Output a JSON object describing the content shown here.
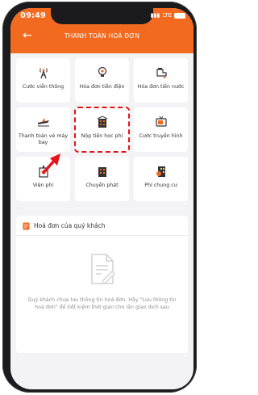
{
  "status": {
    "time": "09:49",
    "network": "LTE"
  },
  "header": {
    "title": "THANH TOÁN HOÁ ĐƠN",
    "back_icon": "arrow-left-icon"
  },
  "services": [
    {
      "label": "Cước viễn thông",
      "icon": "antenna-icon"
    },
    {
      "label": "Hóa đơn tiền điện",
      "icon": "lightbulb-icon"
    },
    {
      "label": "Hóa đơn tiền nước",
      "icon": "water-tap-icon"
    },
    {
      "label": "Thanh toán vé máy bay",
      "icon": "airplane-icon"
    },
    {
      "label": "Nộp tiền học phí",
      "icon": "school-building-icon",
      "highlighted": true
    },
    {
      "label": "Cước truyền hình",
      "icon": "tv-icon"
    },
    {
      "label": "Viện phí",
      "icon": "hospital-icon"
    },
    {
      "label": "Chuyển phát",
      "icon": "building-icon"
    },
    {
      "label": "Phí chung cư",
      "icon": "apartment-icon"
    }
  ],
  "bills": {
    "title": "Hoá đơn của quý khách",
    "empty_message": "Quý khách chưa lưu thông tin hoá đơn. Hãy \"Lưu thông tin hoá đơn\" để tiết kiệm thời gian cho lần giao dịch sau"
  },
  "colors": {
    "accent": "#f16a1f",
    "highlight": "#e8121b"
  }
}
